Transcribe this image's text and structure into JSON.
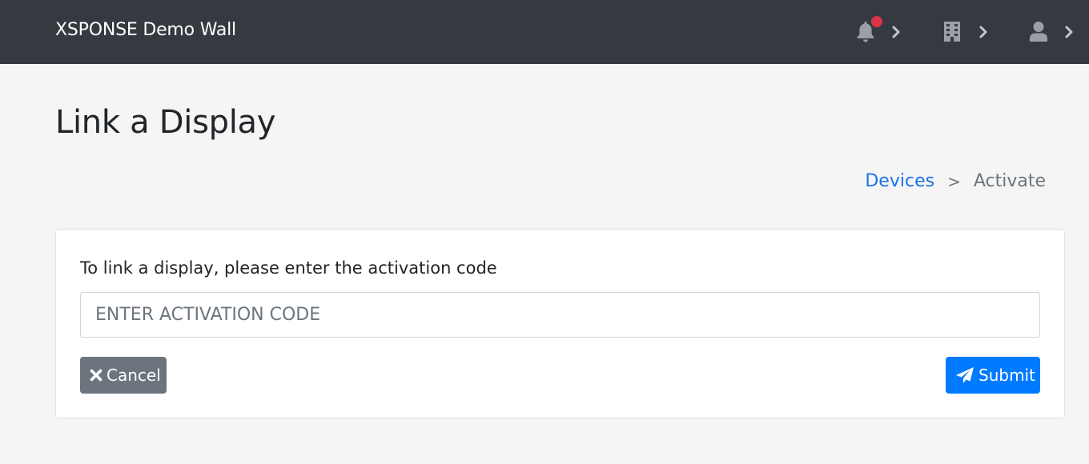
{
  "navbar": {
    "brand": "XSPONSE Demo Wall",
    "items": [
      {
        "icon": "bell-icon",
        "has_badge": true
      },
      {
        "icon": "building-icon",
        "has_badge": false
      },
      {
        "icon": "user-icon",
        "has_badge": false
      }
    ]
  },
  "page": {
    "title": "Link a Display"
  },
  "breadcrumb": {
    "link": "Devices",
    "separator": ">",
    "current": "Activate"
  },
  "form": {
    "prompt": "To link a display, please enter the activation code",
    "input_value": "",
    "input_placeholder": "ENTER ACTIVATION CODE",
    "cancel_label": "Cancel",
    "submit_label": "Submit"
  },
  "colors": {
    "navbar_bg": "#343a40",
    "page_bg": "#f5f5f5",
    "link": "#1a73e8",
    "primary": "#007bff",
    "secondary": "#6c757d",
    "badge": "#dc3545"
  }
}
